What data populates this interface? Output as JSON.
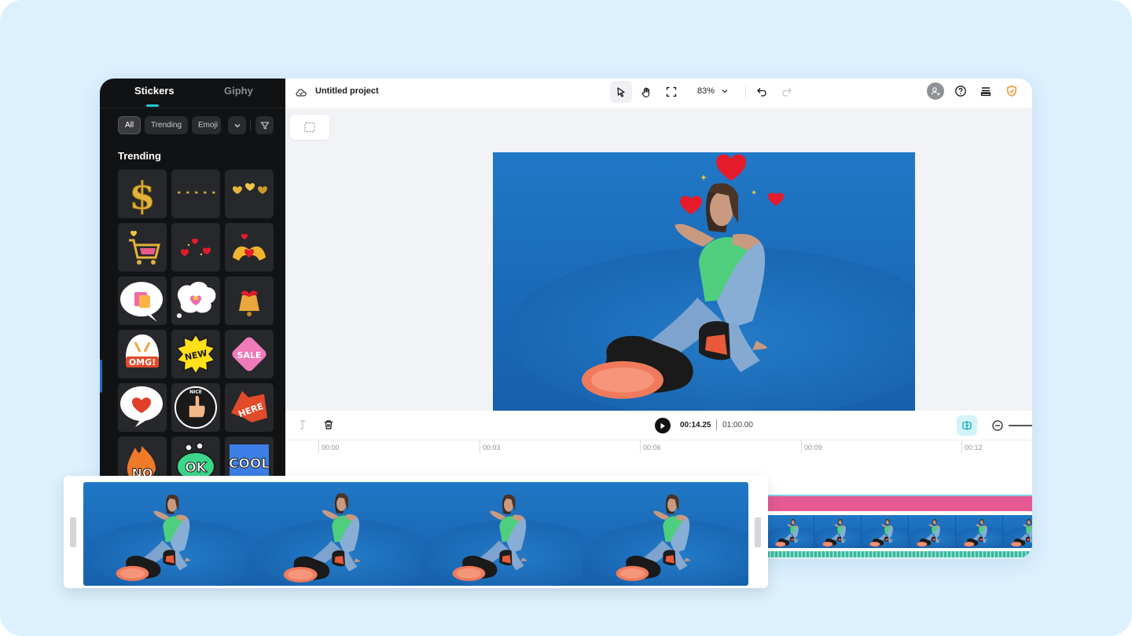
{
  "sidebar": {
    "tabs": [
      {
        "label": "Stickers",
        "active": true
      },
      {
        "label": "Giphy",
        "active": false
      }
    ],
    "chips": [
      {
        "label": "All",
        "active": true
      },
      {
        "label": "Trending",
        "active": false
      },
      {
        "label": "Emoji",
        "active": false
      }
    ],
    "section_title": "Trending",
    "stickers": [
      {
        "name": "dollar-sign-sticker"
      },
      {
        "name": "five-stars-sticker"
      },
      {
        "name": "gold-hearts-sticker"
      },
      {
        "name": "shopping-cart-hearts-sticker"
      },
      {
        "name": "floating-hearts-sticker"
      },
      {
        "name": "heart-hands-sticker"
      },
      {
        "name": "shopping-bag-bubble-sticker"
      },
      {
        "name": "heart-thought-bubble-sticker"
      },
      {
        "name": "bell-sticker"
      },
      {
        "name": "omg-sticker",
        "text": "OMG!"
      },
      {
        "name": "new-badge-sticker",
        "text": "NEW"
      },
      {
        "name": "sale-tag-sticker",
        "text": "SALE"
      },
      {
        "name": "heart-speech-bubble-sticker"
      },
      {
        "name": "nice-thumbs-up-sticker",
        "text": "NICE"
      },
      {
        "name": "here-arrow-sticker",
        "text": "HERE"
      },
      {
        "name": "no-fire-sticker",
        "text": "NO"
      },
      {
        "name": "ok-sticker",
        "text": "OK"
      },
      {
        "name": "cool-sticker",
        "text": "COOL"
      }
    ]
  },
  "topbar": {
    "project_title": "Untitled project",
    "zoom": "83%",
    "icons": [
      "cloud-icon",
      "pointer-icon",
      "hand-icon",
      "fit-screen-icon",
      "chevron-down-icon",
      "undo-icon",
      "redo-icon",
      "avatar-icon",
      "help-icon",
      "layers-icon",
      "shield-icon"
    ]
  },
  "timeline": {
    "current_time": "00:14.25",
    "total_time": "01:00.00",
    "ticks": [
      "00:00",
      "00:03",
      "00:06",
      "00:09",
      "00:12"
    ]
  },
  "colors": {
    "accent": "#22c6d6",
    "stage_bg": "#dcf0fe",
    "sidebar_bg": "#111214",
    "backdrop_blue": "#1c76c6",
    "text_track": "#e45a93"
  }
}
